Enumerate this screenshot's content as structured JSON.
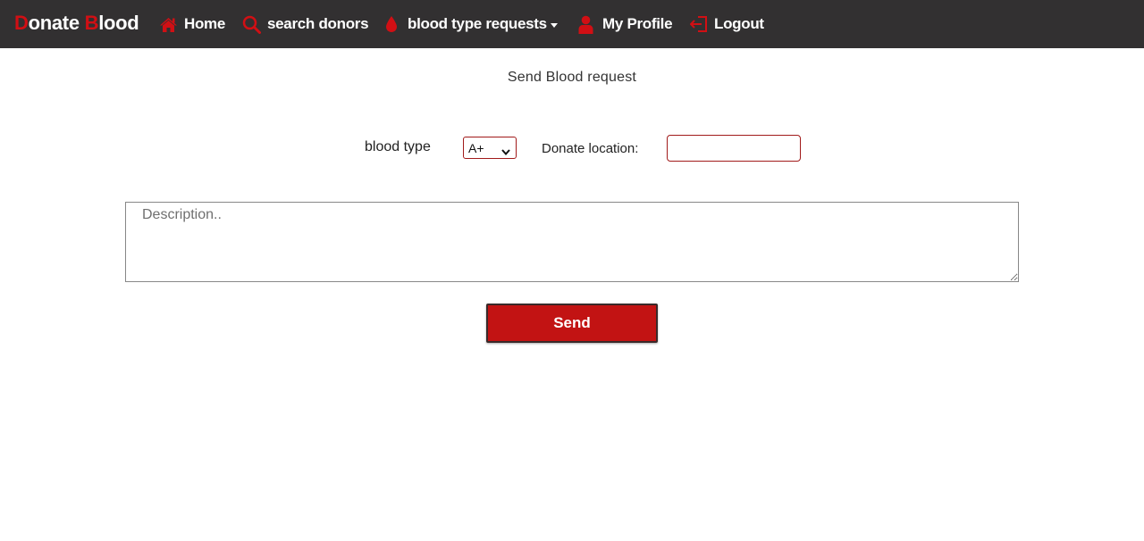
{
  "brand": {
    "first_letter": "D",
    "first_rest": "onate ",
    "second_letter": "B",
    "second_rest": "lood"
  },
  "nav": {
    "home": "Home",
    "search": "search donors",
    "requests": "blood type requests",
    "profile": "My Profile",
    "logout": "Logout"
  },
  "icons": {
    "home": "home-icon",
    "search": "search-icon",
    "requests": "blood-drop-icon",
    "profile": "user-icon",
    "logout": "logout-icon",
    "accent": "#d10f14"
  },
  "page": {
    "title": "Send Blood request"
  },
  "form": {
    "blood_type_label": "blood type",
    "blood_type_value": "A+",
    "location_label": "Donate location:",
    "location_value": "",
    "description_placeholder": "Description..",
    "send_label": "Send"
  },
  "colors": {
    "navbar": "#323031",
    "accent": "#d10f14",
    "button": "#c21313"
  }
}
